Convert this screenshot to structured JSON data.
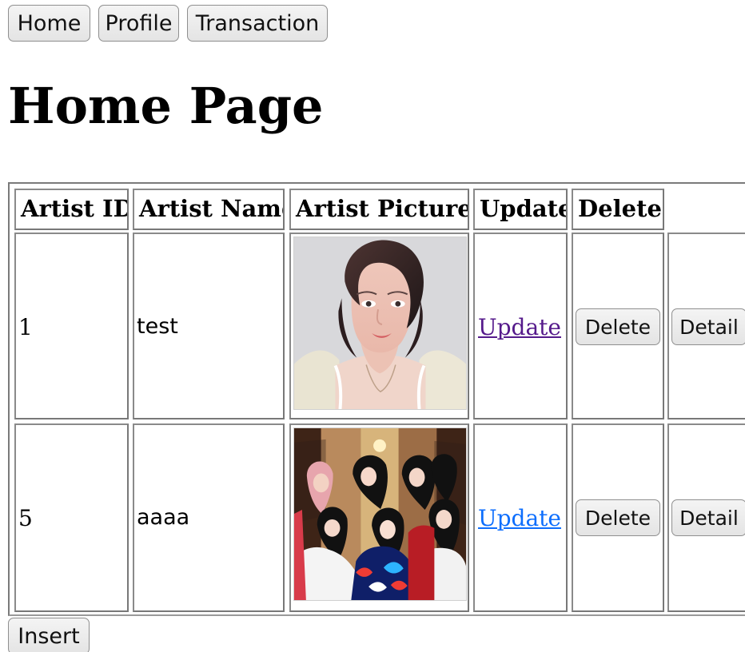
{
  "nav": {
    "home": "Home",
    "profile": "Profile",
    "transaction": "Transaction"
  },
  "page": {
    "title": "Home Page"
  },
  "table": {
    "headers": [
      "Artist ID",
      "Artist Name",
      "Artist Picture",
      "Update",
      "Delete"
    ],
    "rows": [
      {
        "id": "1",
        "name": "test",
        "update_label": "Update",
        "delete_label": "Delete",
        "detail_label": "Detail"
      },
      {
        "id": "5",
        "name": "aaaa",
        "update_label": "Update",
        "delete_label": "Delete",
        "detail_label": "Detail"
      }
    ]
  },
  "actions": {
    "insert": "Insert"
  },
  "colors": {
    "visited_link": "#551a8b",
    "unvisited_link": "#0d6efd"
  },
  "icons": {
    "row-1-picture": "artist-portrait-icon",
    "row-2-picture": "group-photo-icon"
  }
}
